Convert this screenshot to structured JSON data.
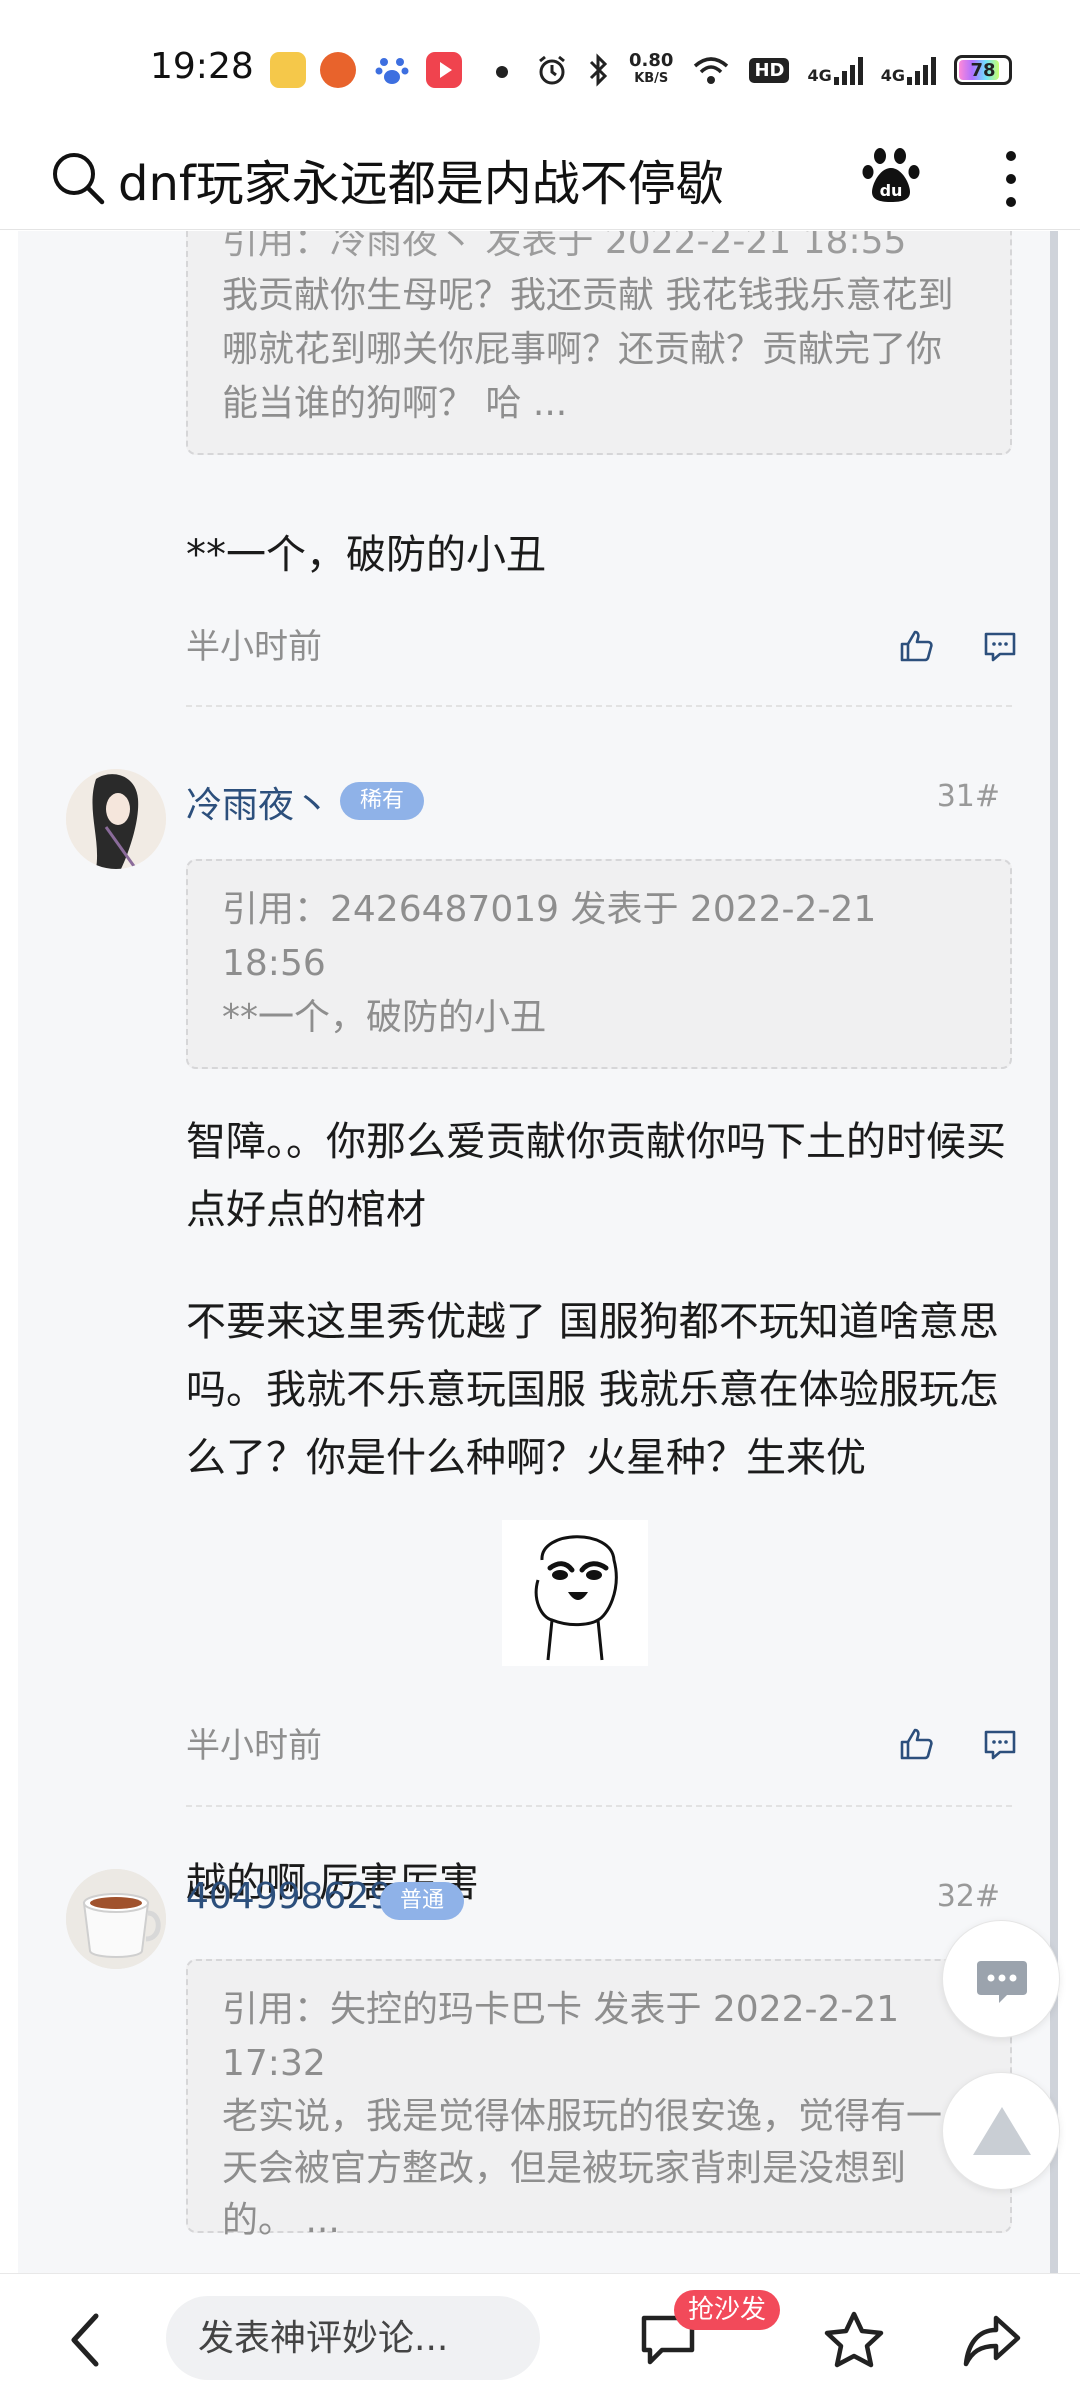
{
  "status_bar": {
    "time": "19:28",
    "net_speed_value": "0.80",
    "net_speed_unit": "KB/S",
    "hd_label": "HD",
    "signal_1": "4G",
    "signal_2": "4G",
    "battery": "78"
  },
  "header": {
    "title": "dnf玩家永远都是内战不停歇"
  },
  "posts": [
    {
      "quote_header_partial": "引用：冷雨夜丶 发表于 2022-2-21 18:55",
      "quote_text": "我贡献你生母呢？我还贡献 我花钱我乐意花到哪就花到哪关你屁事啊？还贡献？贡献完了你能当谁的狗啊？ 哈 ...",
      "text": "**一个，破防的小丑",
      "time": "半小时前"
    },
    {
      "username": "冷雨夜丶",
      "badge": "稀有",
      "floor": "31#",
      "quote_header": "引用：2426487019 发表于 2022-2-21 18:56",
      "quote_text": "**一个，破防的小丑",
      "text_p1": "智障。。你那么爱贡献你贡献你吗下土的时候买点好点的棺材",
      "text_p2": "不要来这里秀优越了 国服狗都不玩知道啥意思吗。我就不乐意玩国服 我就乐意在体验服玩怎么了？你是什么种啊？火星种？生来优",
      "text_p3": "越的啊  厉害厉害",
      "time": "半小时前"
    },
    {
      "username": "404998629",
      "badge": "普通",
      "floor": "32#",
      "quote_header": "引用：失控的玛卡巴卡 发表于 2022-2-21 17:32",
      "quote_text": "老实说，我是觉得体服玩的很安逸，觉得有一天会被官方整改，但是被玩家背刺是没想到的。 ..."
    }
  ],
  "bottom_bar": {
    "comment_placeholder": "发表神评妙论...",
    "sofa_badge": "抢沙发"
  }
}
